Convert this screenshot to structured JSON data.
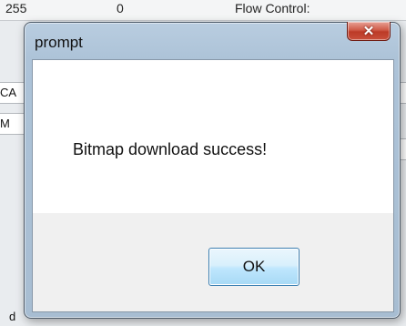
{
  "background": {
    "top_left_text": "255",
    "top_mid_text": "0",
    "top_right_text": "Flow Control:",
    "edge_field_1": "CA",
    "edge_field_2": "M",
    "bottom_mark": "d"
  },
  "dialog": {
    "title": "prompt",
    "close_glyph": "✕",
    "message": "Bitmap download success!",
    "ok_label": "OK"
  }
}
